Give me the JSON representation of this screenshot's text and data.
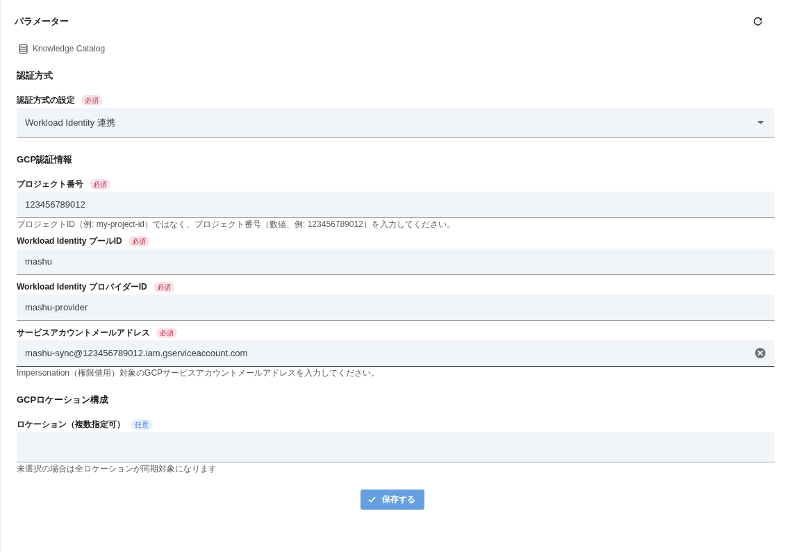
{
  "panel": {
    "title": "パラメーター"
  },
  "catalog": {
    "label": "Knowledge Catalog"
  },
  "sections": [
    {
      "title": "認証方式",
      "fields": [
        {
          "kind": "select",
          "label": "認証方式の設定",
          "badge": {
            "kind": "required",
            "text": "必須"
          },
          "value": "Workload Identity 連携"
        }
      ]
    },
    {
      "title": "GCP認証情報",
      "fields": [
        {
          "kind": "text",
          "label": "プロジェクト番号",
          "badge": {
            "kind": "required",
            "text": "必須"
          },
          "value": "123456789012",
          "focused": false,
          "helper": "プロジェクトID（例: my-project-id）ではなく、プロジェクト番号（数値、例: 123456789012）を入力してください。"
        },
        {
          "kind": "text",
          "label": "Workload Identity プールID",
          "badge": {
            "kind": "required",
            "text": "必須"
          },
          "value": "mashu",
          "focused": false
        },
        {
          "kind": "text",
          "label": "Workload Identity プロバイダーID",
          "badge": {
            "kind": "required",
            "text": "必須"
          },
          "value": "mashu-provider",
          "focused": false
        },
        {
          "kind": "text",
          "label": "サービスアカウントメールアドレス",
          "badge": {
            "kind": "required",
            "text": "必須"
          },
          "value": "mashu-sync@123456789012.iam.gserviceaccount.com",
          "focused": true,
          "helper": "Impersonation（権限借用）対象のGCPサービスアカウントメールアドレスを入力してください。"
        }
      ]
    },
    {
      "title": "GCPロケーション構成",
      "fields": [
        {
          "kind": "multiselect",
          "label": "ロケーション（複数指定可）",
          "badge": {
            "kind": "optional",
            "text": "任意"
          },
          "helper": "未選択の場合は全ロケーションが同期対象になります"
        }
      ]
    }
  ],
  "save_button": {
    "label": "保存する"
  }
}
